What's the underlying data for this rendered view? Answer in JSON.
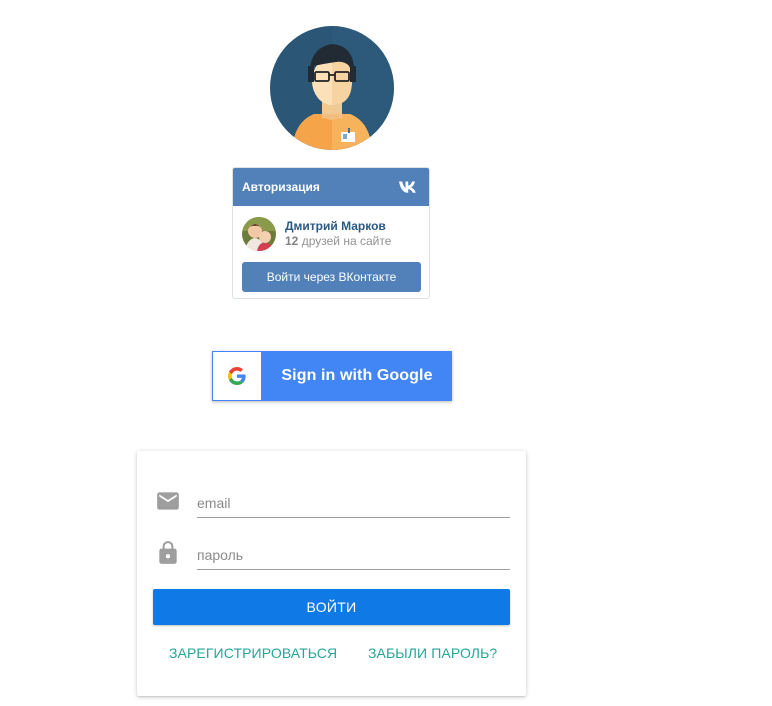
{
  "vk_widget": {
    "title": "Авторизация",
    "logo_icon": "vk-logo-icon",
    "user": {
      "name": "Дмитрий Марков",
      "friends_count": "12",
      "friends_suffix": "друзей на сайте"
    },
    "login_label": "Войти через ВКонтакте"
  },
  "google": {
    "label": "Sign in with Google",
    "icon": "google-g-icon"
  },
  "login_form": {
    "email_placeholder": "email",
    "password_placeholder": "пароль",
    "email_icon": "mail-icon",
    "password_icon": "lock-icon",
    "submit_label": "ВОЙТИ",
    "register_label": "ЗАРЕГИСТРИРОВАТЬСЯ",
    "forgot_label": "ЗАБЫЛИ ПАРОЛЬ?"
  },
  "colors": {
    "vk_blue": "#5181b8",
    "google_blue": "#4285f4",
    "submit_blue": "#0f7ae5",
    "link_teal": "#26a69a"
  }
}
